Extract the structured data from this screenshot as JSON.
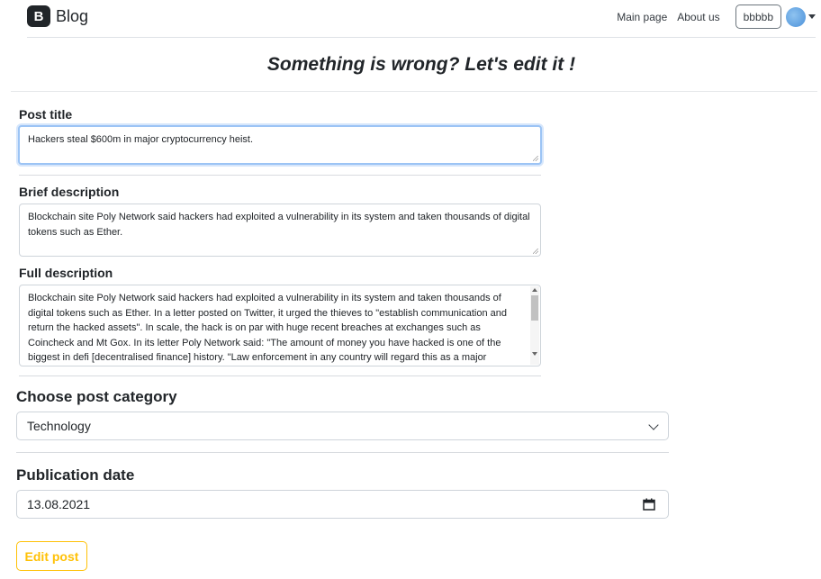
{
  "navbar": {
    "brand_logo": "B",
    "brand_text": "Blog",
    "links": [
      "Main page",
      "About us"
    ],
    "user_button": "bbbbb"
  },
  "page": {
    "heading": "Something is wrong? Let's edit it !"
  },
  "form": {
    "post_title_label": "Post title",
    "post_title_value": "Hackers steal $600m in major cryptocurrency heist.",
    "brief_label": "Brief description",
    "brief_value": "Blockchain site Poly Network said hackers had exploited a vulnerability in its system and taken thousands of digital tokens such as Ether.",
    "full_label": "Full description",
    "full_value": "Blockchain site Poly Network said hackers had exploited a vulnerability in its system and taken thousands of digital tokens such as Ether.  In a letter posted on Twitter, it urged the thieves to \"establish communication and return the hacked assets\".  In scale, the hack is on par with huge recent breaches at exchanges such as Coincheck and Mt Gox.  In its letter Poly Network said: \"The amount of money you have hacked is one of the biggest in defi [decentralised finance] history.  \"Law enforcement in any country will regard this as a major economic crime and you will be",
    "category_label": "Choose post category",
    "category_value": "Technology",
    "date_label": "Publication date",
    "date_value": "13.08.2021",
    "submit_label": "Edit post"
  },
  "colors": {
    "accent_warning": "#ffc107",
    "focus_border": "#9cc4f5"
  }
}
